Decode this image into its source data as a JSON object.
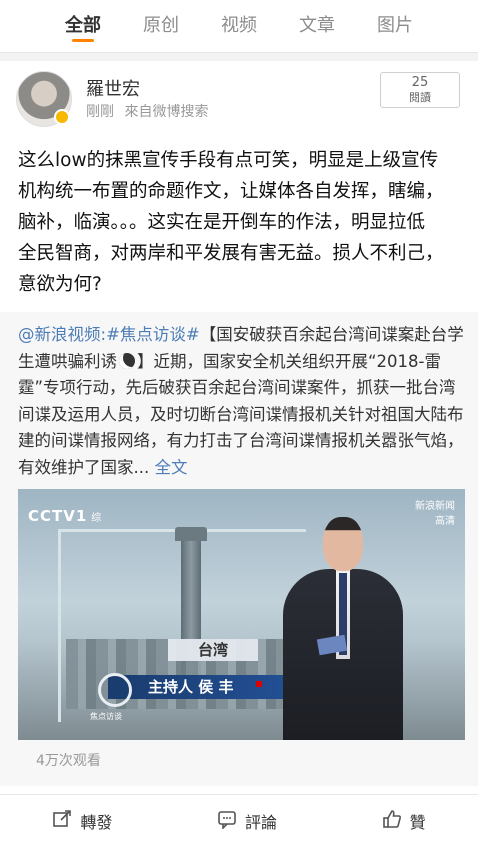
{
  "tabs": [
    "全部",
    "原创",
    "视频",
    "文章",
    "图片"
  ],
  "post": {
    "username": "羅世宏",
    "time": "剛剛",
    "source": "來自微博搜索",
    "reads_count": "25",
    "reads_label": "閱讀",
    "text_lines": [
      "这么low的抹黑宣传手段有点可笑，明显是上级宣传",
      "机构统一布置的命题作文，让媒体各自发挥，瞎编，",
      "脑补，临演。。。这实在是开倒车的作法，明显拉低",
      "全民智商，对两岸和平发展有害无益。损人不利己，",
      "意欲为何?"
    ]
  },
  "repost": {
    "mention": "@新浪视频",
    "colon": ":",
    "topic": "#焦点访谈#",
    "headline_part1": "【国安破获百余起台湾间谍案",
    "headline_part2": "赴台学生遭哄骗利诱",
    "headline_close": "】",
    "body": "近期，国家安全机关组织开展“2018-雷霆”专项行动，先后破获百余起台湾间谍案件，抓获一批台湾间谍及运用人员，及时切断台湾间谍情报机关针对祖国大陆布建的间谍情报网络，有力打击了台湾间谍情报机关嚣张气焰，有效维护了国家...",
    "full_text_link": "全文"
  },
  "video": {
    "channel": "CCTV",
    "channel_num": "1",
    "channel_sub": "综",
    "watermark_line1": "新浪新闻",
    "watermark_line2": "高清",
    "caption_location": "台湾",
    "program_logo_text": "焦点访谈",
    "host_label": "主持人  侯  丰"
  },
  "views": "4万次观看",
  "actions": {
    "repost": "轉發",
    "comment": "評論",
    "like": "贊"
  },
  "colors": {
    "accent": "#ff8200",
    "link": "#4d7db7"
  }
}
